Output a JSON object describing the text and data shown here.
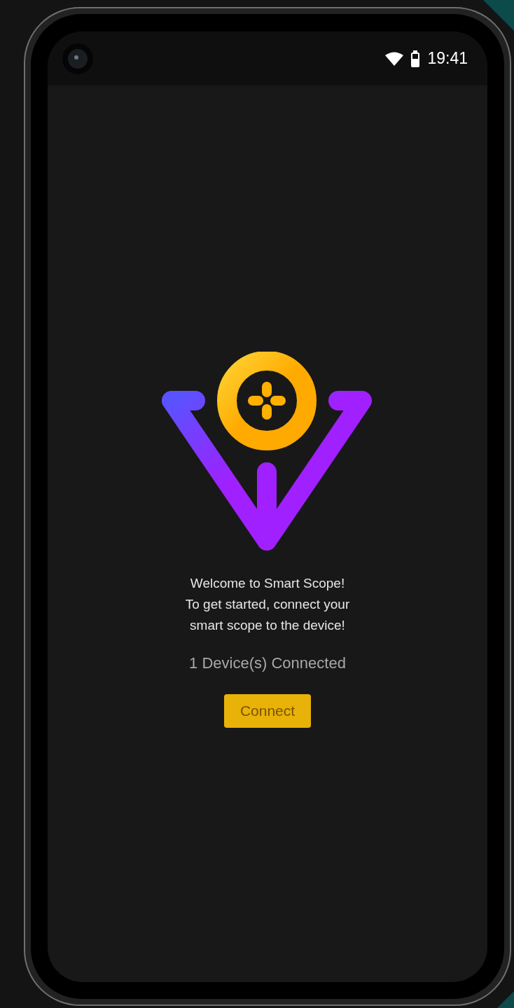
{
  "status_bar": {
    "time": "19:41"
  },
  "welcome": {
    "lines": [
      "Welcome to Smart Scope!",
      "To get started, connect your",
      "smart scope to the device!"
    ]
  },
  "device_status": "1 Device(s) Connected",
  "connect_button": {
    "label": "Connect"
  }
}
